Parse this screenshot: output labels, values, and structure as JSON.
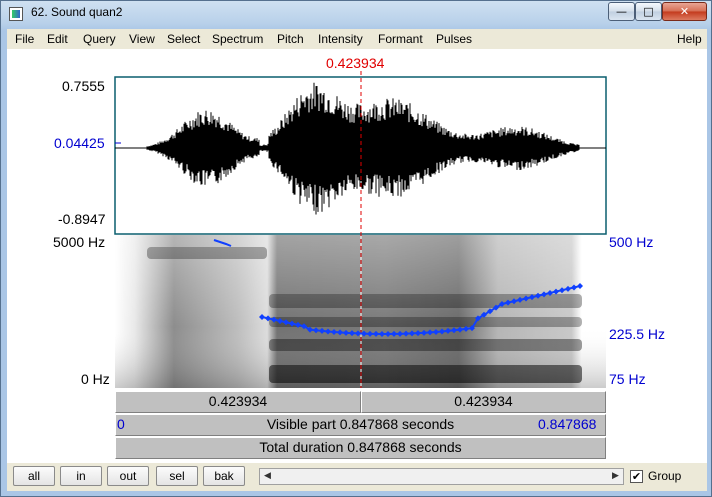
{
  "window": {
    "title": "62. Sound quan2",
    "buttons": {
      "minimize": "—",
      "maximize": "□",
      "close": "✕"
    }
  },
  "menu": [
    "File",
    "Edit",
    "Query",
    "View",
    "Select",
    "Spectrum",
    "Pitch",
    "Intensity",
    "Formant",
    "Pulses",
    "Help"
  ],
  "cursor": {
    "time_label": "0.423934"
  },
  "waveform": {
    "max_label": "0.7555",
    "cursor_value_label": "0.04425",
    "min_label": "-0.8947"
  },
  "spectrogram": {
    "top_freq_label": "5000 Hz",
    "bottom_freq_label": "0 Hz",
    "pitch_top_label": "500 Hz",
    "pitch_mid_label": "225.5 Hz",
    "pitch_bottom_label": "75 Hz"
  },
  "bars": {
    "left_segment": "0.423934",
    "right_segment": "0.423934",
    "visible_start": "0",
    "visible_text": "Visible part 0.847868 seconds",
    "visible_end": "0.847868",
    "total_text": "Total duration 0.847868 seconds"
  },
  "toolbar": {
    "buttons": [
      "all",
      "in",
      "out",
      "sel",
      "bak"
    ],
    "group_label": "Group",
    "group_checked": true
  },
  "colors": {
    "cursor": "#e00000",
    "pitch": "#1040ff",
    "frame": "#0a5f6f"
  }
}
